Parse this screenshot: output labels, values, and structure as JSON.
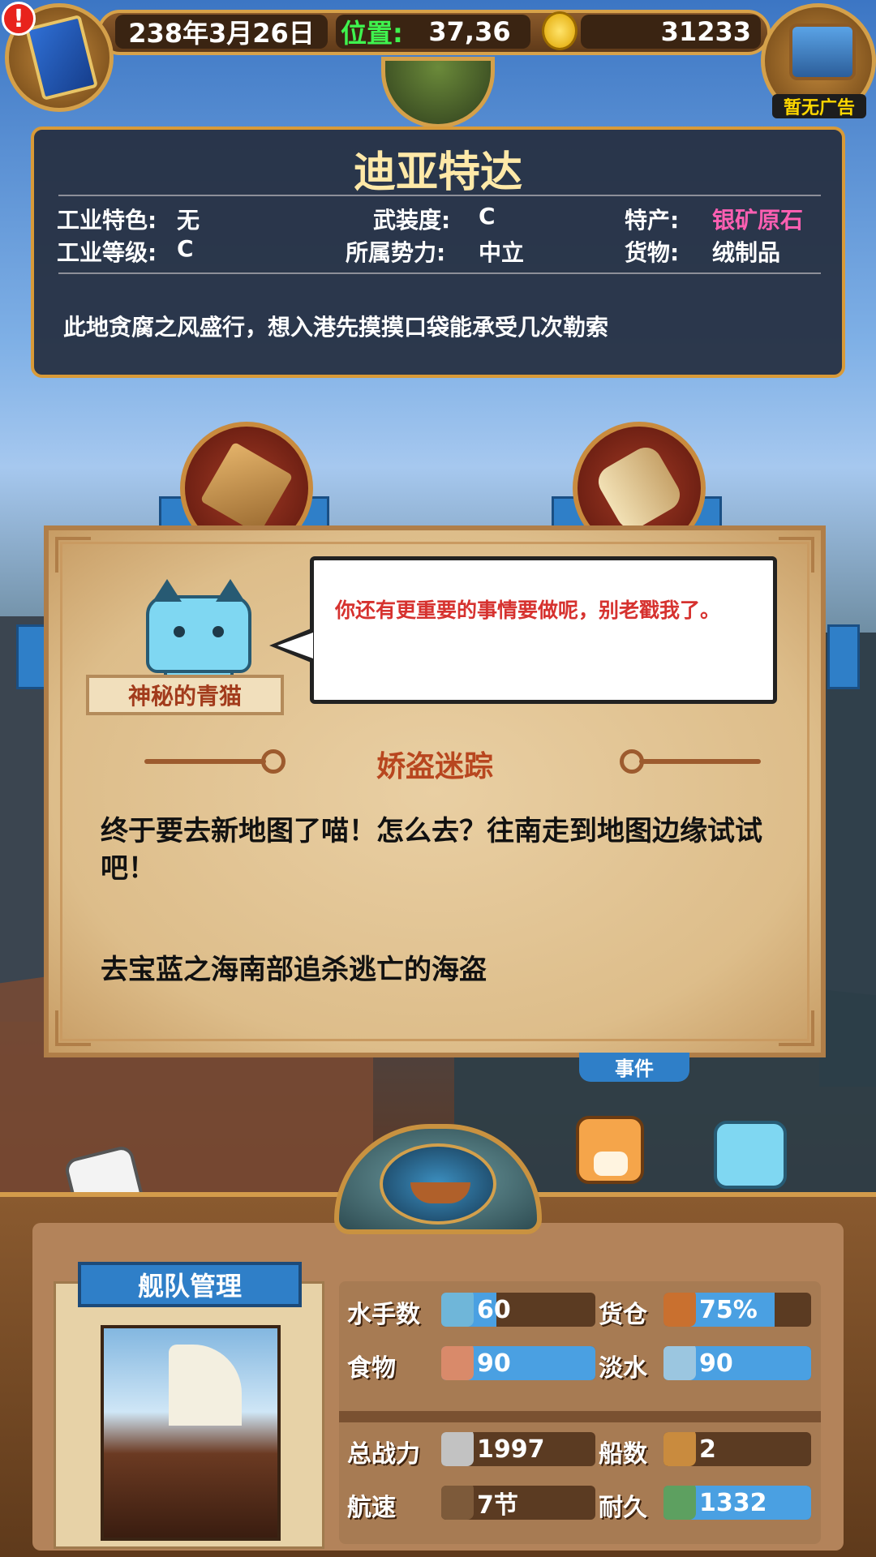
{
  "topbar": {
    "date": "238年3月26日",
    "position_label": "位置:",
    "position_value": "37,36",
    "gold": "31233",
    "alert_glyph": "!",
    "chest_label": "暂无广告"
  },
  "city": {
    "name": "迪亚特达",
    "rows": [
      {
        "label1": "工业特色:",
        "value1": "无",
        "label2": "武装度:",
        "value2": "C",
        "label3": "特产:",
        "value3": "银矿原石"
      },
      {
        "label1": "工业等级:",
        "value1": "C",
        "label2": "所属势力:",
        "value2": "中立",
        "label3": "货物:",
        "value3": "绒制品"
      }
    ],
    "description": "此地贪腐之风盛行，想入港先摸摸口袋能承受几次勒索"
  },
  "dialog": {
    "speaker": "神秘的青猫",
    "speech": "你还有更重要的事情要做呢，别老戳我了。",
    "quest_title": "娇盗迷踪",
    "quest_body": "终于要去新地图了喵！怎么去？往南走到地图边缘试试吧！",
    "quest_goal": "去宝蓝之海南部追杀逃亡的海盗"
  },
  "event_button": "事件",
  "fleet": {
    "title": "舰队管理",
    "stats": [
      {
        "label": "水手数",
        "value": "60",
        "fill": 0.36,
        "icon": "sailor-icon"
      },
      {
        "label": "货仓",
        "value": "75%",
        "fill": 0.75,
        "icon": "cargo-icon"
      },
      {
        "label": "食物",
        "value": "90",
        "fill": 1.0,
        "icon": "food-icon"
      },
      {
        "label": "淡水",
        "value": "90",
        "fill": 1.0,
        "icon": "water-icon"
      },
      {
        "label": "总战力",
        "value": "1997",
        "fill": 0.0,
        "icon": "crossed-swords-icon"
      },
      {
        "label": "船数",
        "value": "2",
        "fill": 0.0,
        "icon": "boat-icon"
      },
      {
        "label": "航速",
        "value": "7节",
        "fill": 0.0,
        "icon": "sailing-ship-icon"
      },
      {
        "label": "耐久",
        "value": "1332",
        "fill": 1.0,
        "icon": "durability-icon"
      }
    ]
  },
  "colors": {
    "accent_gold": "#d89a38",
    "stat_fill": "#4aa0e2",
    "speech_red": "#d6322f",
    "special_pink": "#ff5fb2"
  }
}
